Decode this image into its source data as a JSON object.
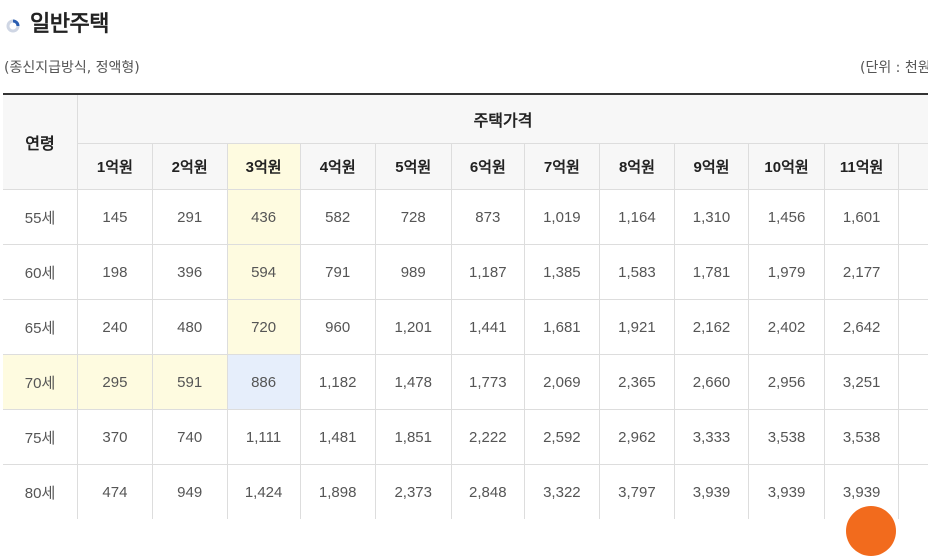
{
  "heading": {
    "title": "일반주택",
    "icon": "half-circle-icon"
  },
  "subtitle": "(종신지급방식, 정액형)",
  "unit": "(단위 : 천원",
  "table": {
    "age_header": "연령",
    "group_header": "주택가격",
    "columns": [
      "1억원",
      "2억원",
      "3억원",
      "4억원",
      "5억원",
      "6억원",
      "7억원",
      "8억원",
      "9억원",
      "10억원",
      "11억원"
    ],
    "rows": [
      {
        "age": "55세",
        "values": [
          "145",
          "291",
          "436",
          "582",
          "728",
          "873",
          "1,019",
          "1,164",
          "1,310",
          "1,456",
          "1,601"
        ]
      },
      {
        "age": "60세",
        "values": [
          "198",
          "396",
          "594",
          "791",
          "989",
          "1,187",
          "1,385",
          "1,583",
          "1,781",
          "1,979",
          "2,177"
        ]
      },
      {
        "age": "65세",
        "values": [
          "240",
          "480",
          "720",
          "960",
          "1,201",
          "1,441",
          "1,681",
          "1,921",
          "2,162",
          "2,402",
          "2,642"
        ]
      },
      {
        "age": "70세",
        "values": [
          "295",
          "591",
          "886",
          "1,182",
          "1,478",
          "1,773",
          "2,069",
          "2,365",
          "2,660",
          "2,956",
          "3,251"
        ]
      },
      {
        "age": "75세",
        "values": [
          "370",
          "740",
          "1,111",
          "1,481",
          "1,851",
          "2,222",
          "2,592",
          "2,962",
          "3,333",
          "3,538",
          "3,538"
        ]
      },
      {
        "age": "80세",
        "values": [
          "474",
          "949",
          "1,424",
          "1,898",
          "2,373",
          "2,848",
          "3,322",
          "3,797",
          "3,939",
          "3,939",
          "3,939"
        ]
      }
    ]
  },
  "colors": {
    "highlight_yellow": "#fefbe0",
    "highlight_blue": "#e6eefb",
    "accent_orange": "#f26b1d",
    "icon_blue": "#2a5db0"
  }
}
